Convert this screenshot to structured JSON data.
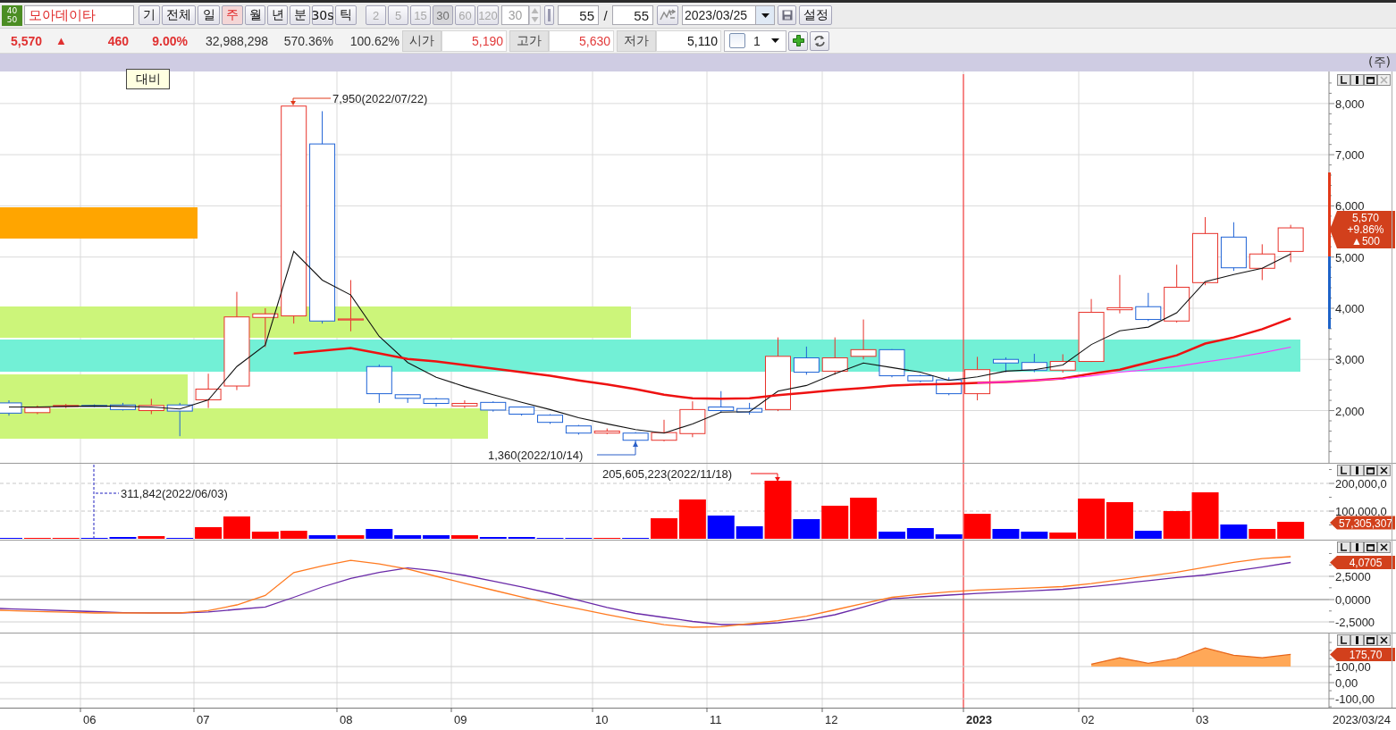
{
  "toolbar": {
    "badge": [
      "40",
      "50"
    ],
    "stock_name": "모아데이타",
    "period_buttons": [
      {
        "label": "기",
        "selected": false
      },
      {
        "label": "전체",
        "selected": false
      },
      {
        "label": "일",
        "selected": false
      },
      {
        "label": "주",
        "selected": true
      },
      {
        "label": "월",
        "selected": false
      },
      {
        "label": "년",
        "selected": false
      },
      {
        "label": "분",
        "selected": false
      },
      {
        "label": "30s",
        "selected": false
      },
      {
        "label": "틱",
        "selected": false
      }
    ],
    "interval_buttons": [
      {
        "label": "2",
        "selected": false,
        "disabled": true
      },
      {
        "label": "5",
        "selected": false,
        "disabled": true
      },
      {
        "label": "15",
        "selected": false,
        "disabled": true
      },
      {
        "label": "30",
        "selected": true,
        "disabled": true
      },
      {
        "label": "60",
        "selected": false,
        "disabled": true
      },
      {
        "label": "120",
        "selected": false,
        "disabled": true
      }
    ],
    "interval_value": "30",
    "interval_disabled": true,
    "bar_count": "55",
    "slash": "/",
    "bar_total": "55",
    "date": "2023/03/25",
    "settings_label": "설정"
  },
  "quote": {
    "price": "5,570",
    "direction": "▲",
    "change": "460",
    "change_rate": "9.00%",
    "stats": [
      "32,988,298",
      "570.36%",
      "100.62%"
    ],
    "ohlc": [
      {
        "label": "시가",
        "value": "5,190",
        "color": "#e23a3a"
      },
      {
        "label": "고가",
        "value": "5,630",
        "color": "#e23a3a"
      },
      {
        "label": "저가",
        "value": "5,110",
        "color": "#111111"
      }
    ],
    "quantity": {
      "checked": false,
      "value": "1"
    }
  },
  "chart": {
    "unit_label": "(주)",
    "compare_label": "대비",
    "panels": [
      {
        "close_disabled": true
      },
      {
        "close_disabled": false
      },
      {
        "close_disabled": false
      },
      {
        "close_disabled": false
      }
    ],
    "price_panel": {
      "chart_data": {
        "type": "line",
        "grid": true,
        "ylim": [
          970,
          8626
        ],
        "yticks": [
          {
            "value": 8000,
            "label": "8,000"
          },
          {
            "value": 7000,
            "label": "7,000"
          },
          {
            "value": 6000,
            "label": "6,000"
          },
          {
            "value": 5000,
            "label": "5,000"
          },
          {
            "value": 4000,
            "label": "4,000"
          },
          {
            "value": 3000,
            "label": "3,000"
          },
          {
            "value": 2000,
            "label": "2,000"
          }
        ],
        "series": [
          {
            "color": "#111111",
            "values": [
              2070,
              2070,
              2080,
              2090,
              2080,
              2070,
              2030,
              2210,
              2860,
              3280,
              5110,
              4550,
              4260,
              3450,
              2940,
              2650,
              2470,
              2310,
              2160,
              2020,
              1860,
              1740,
              1630,
              1560,
              1740,
              1970,
              1980,
              2380,
              2490,
              2720,
              2930,
              2840,
              2750,
              2590,
              2660,
              2770,
              2800,
              2890,
              3290,
              3560,
              3630,
              3910,
              4520,
              4660,
              4780,
              5060
            ]
          },
          {
            "color": "#ee1111",
            "values": [
              null,
              null,
              null,
              null,
              null,
              null,
              null,
              null,
              null,
              null,
              3120,
              3170,
              3220,
              3120,
              3010,
              2960,
              2890,
              2820,
              2750,
              2680,
              2590,
              2510,
              2420,
              2310,
              2240,
              2230,
              2240,
              2300,
              2350,
              2400,
              2440,
              2490,
              2510,
              2520,
              2540,
              2560,
              2590,
              2630,
              2720,
              2800,
              2940,
              3080,
              3310,
              3430,
              3590,
              3800
            ]
          },
          {
            "color": "#ff33ff",
            "values": [
              null,
              null,
              null,
              null,
              null,
              null,
              null,
              null,
              null,
              null,
              null,
              null,
              null,
              null,
              null,
              null,
              null,
              null,
              null,
              null,
              null,
              null,
              null,
              null,
              null,
              null,
              null,
              null,
              null,
              null,
              null,
              null,
              null,
              null,
              2540,
              2560,
              2590,
              2620,
              2680,
              2750,
              2800,
              2860,
              2950,
              3030,
              3130,
              3240
            ]
          }
        ]
      },
      "price_tag": [
        "5,570",
        "+9.86%",
        "▲500"
      ],
      "annotations": [
        {
          "kind": "high",
          "text": "7,950(2022/07/22)"
        },
        {
          "kind": "low",
          "text": "1,360(2022/10/14)"
        }
      ]
    },
    "volume_panel": {
      "axis_labels": [
        "200,000,0",
        "100,000,0"
      ],
      "tag": "57,305,307",
      "annotations": [
        {
          "kind": "high",
          "text": "205,605,223(2022/11/18)"
        },
        {
          "kind": "low",
          "text": "311,842(2022/06/03)"
        }
      ]
    },
    "macd_panel": {
      "axis_labels": [
        "2,5000",
        "0,0000",
        "-2,5000"
      ],
      "tag": "4,0705"
    },
    "oscillator_panel": {
      "chart_data": {
        "type": "area",
        "grid": true,
        "ylim": [
          -158,
          305
        ],
        "yticks": [
          {
            "value": 100,
            "label": "100,00"
          },
          {
            "value": 0,
            "label": "0,00"
          },
          {
            "value": -100,
            "label": "-100,00"
          }
        ],
        "series": [
          {
            "color": "#ffa858",
            "values": [
              null,
              null,
              null,
              null,
              null,
              null,
              null,
              null,
              null,
              null,
              null,
              null,
              null,
              null,
              null,
              null,
              null,
              null,
              null,
              null,
              null,
              null,
              null,
              null,
              null,
              null,
              null,
              null,
              null,
              null,
              null,
              null,
              null,
              null,
              null,
              null,
              null,
              null,
              115,
              155,
              120,
              150,
              215,
              170,
              155,
              175
            ]
          }
        ]
      },
      "tag": "175,70"
    },
    "x_labels": [
      {
        "label": "06",
        "kind": "month"
      },
      {
        "label": "07",
        "kind": "month"
      },
      {
        "label": "08",
        "kind": "month"
      },
      {
        "label": "09",
        "kind": "month"
      },
      {
        "label": "10",
        "kind": "month"
      },
      {
        "label": "11",
        "kind": "month"
      },
      {
        "label": "12",
        "kind": "month"
      },
      {
        "label": "2023",
        "kind": "year"
      },
      {
        "label": "02",
        "kind": "month"
      },
      {
        "label": "03",
        "kind": "month"
      }
    ],
    "end_date": "2023/03/24"
  }
}
